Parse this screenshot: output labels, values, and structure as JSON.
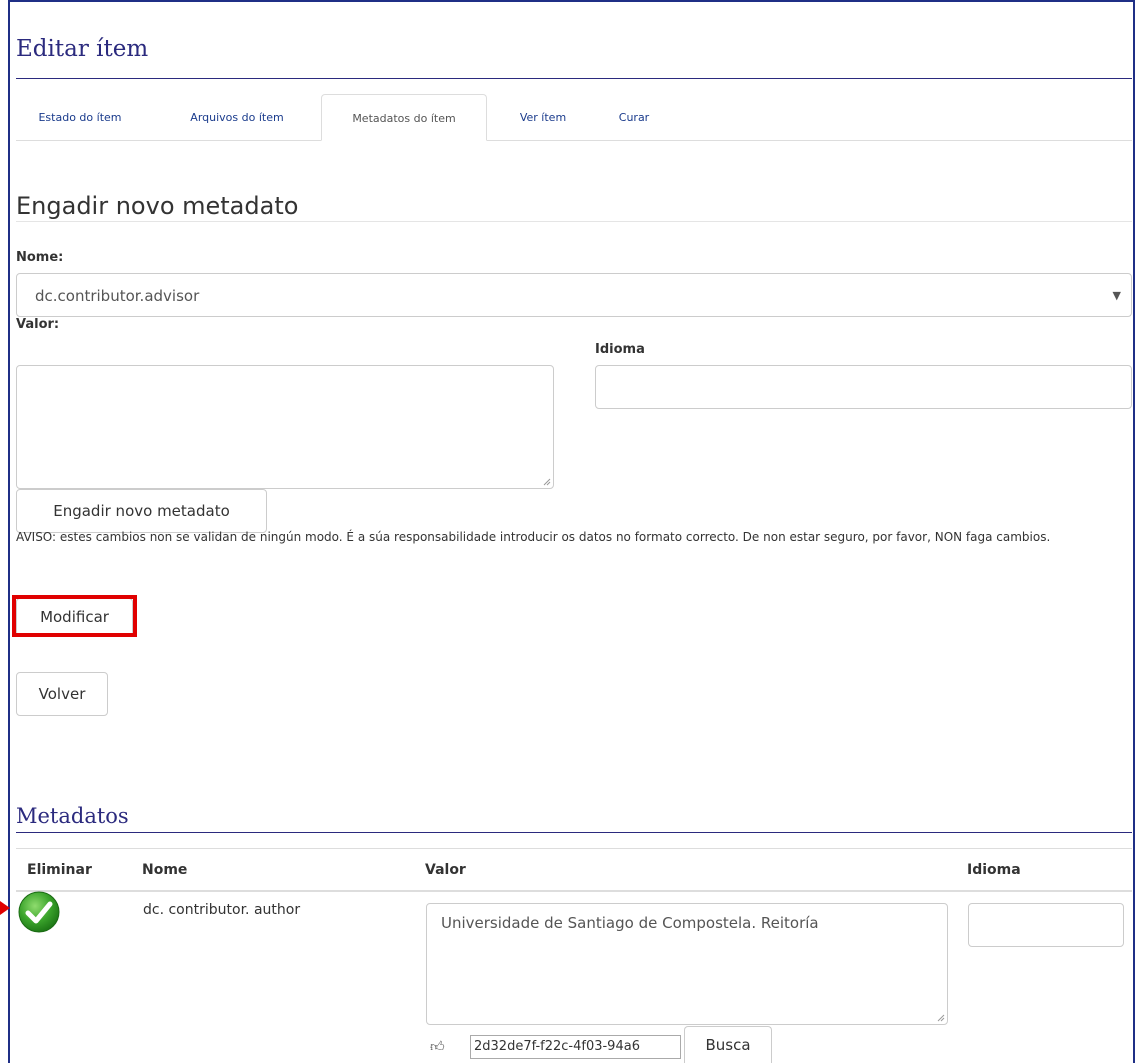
{
  "page": {
    "edit_title": "Editar ítem",
    "tabs": [
      {
        "label": "Estado do ítem"
      },
      {
        "label": "Arquivos do ítem"
      },
      {
        "label": "Metadatos do ítem",
        "active": true
      },
      {
        "label": "Ver ítem"
      },
      {
        "label": "Curar"
      }
    ]
  },
  "add_section": {
    "title": "Engadir novo metadato",
    "name_label": "Nome:",
    "name_selected": "dc.contributor.advisor",
    "value_label": "Valor:",
    "language_label": "Idioma",
    "value_text": "",
    "language_text": "",
    "add_button": "Engadir novo metadato",
    "warning": "AVISO: estes cambios non se validan de ningún modo. É a súa responsabilidade introducir os datos no formato correcto. De non estar seguro, por favor, NON faga cambios.",
    "modify_button": "Modificar",
    "back_button": "Volver"
  },
  "metadata_table": {
    "title": "Metadatos",
    "headers": {
      "delete": "Eliminar",
      "name": "Nome",
      "value": "Valor",
      "language": "Idioma"
    },
    "rows": [
      {
        "name": "dc. contributor. author",
        "value": "Universidade de Santiago de Compostela. Reitoría",
        "language": "",
        "authority_value": "2d32de7f-f22c-4f03-94a6",
        "search_button": "Busca",
        "status_icon": "check-circle-icon",
        "authority_icon": "thumbs-up-icon"
      }
    ]
  },
  "colors": {
    "frame": "#1f2f86",
    "heading": "#2b2a7e",
    "tab_link": "#1a3b8c",
    "highlight": "#e00000",
    "check": "#3aa32b"
  }
}
